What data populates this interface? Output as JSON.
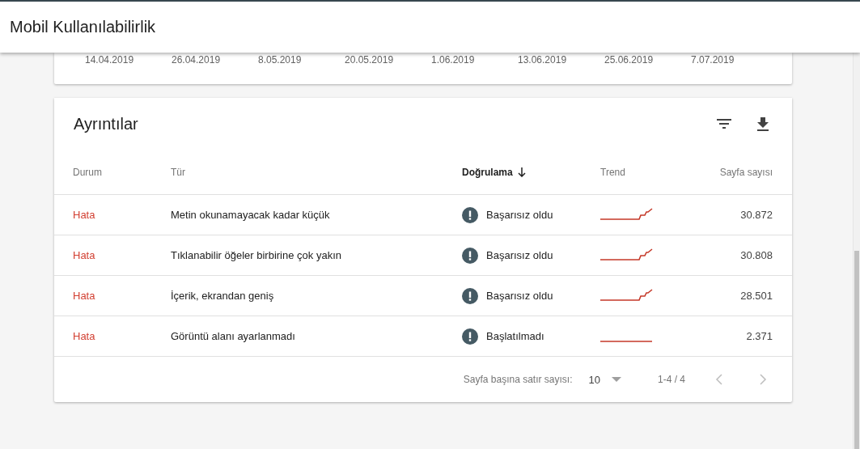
{
  "header": {
    "title": "Mobil Kullanılabilirlik"
  },
  "chart_axis": {
    "labels": [
      "14.04.2019",
      "26.04.2019",
      "8.05.2019",
      "20.05.2019",
      "1.06.2019",
      "13.06.2019",
      "25.06.2019",
      "7.07.2019"
    ]
  },
  "details": {
    "title": "Ayrıntılar",
    "columns": [
      {
        "label": "Durum",
        "sorted": false
      },
      {
        "label": "Tür",
        "sorted": false
      },
      {
        "label": "Doğrulama",
        "sorted": true
      },
      {
        "label": "Trend",
        "sorted": false
      },
      {
        "label": "Sayfa sayısı",
        "sorted": false
      }
    ],
    "rows": [
      {
        "status": "Hata",
        "type": "Metin okunamayacak kadar küçük",
        "validation": "Başarısız oldu",
        "kind": "rising",
        "pages": "30.872"
      },
      {
        "status": "Hata",
        "type": "Tıklanabilir öğeler birbirine çok yakın",
        "validation": "Başarısız oldu",
        "kind": "rising",
        "pages": "30.808"
      },
      {
        "status": "Hata",
        "type": "İçerik, ekrandan geniş",
        "validation": "Başarısız oldu",
        "kind": "rising",
        "pages": "28.501"
      },
      {
        "status": "Hata",
        "type": "Görüntü alanı ayarlanmadı",
        "validation": "Başlatılmadı",
        "kind": "flat",
        "pages": "2.371"
      }
    ],
    "pagination": {
      "rows_label": "Sayfa başına satır sayısı:",
      "rows_value": "10",
      "range": "1-4 / 4",
      "prev_disabled": true,
      "next_disabled": true
    }
  }
}
